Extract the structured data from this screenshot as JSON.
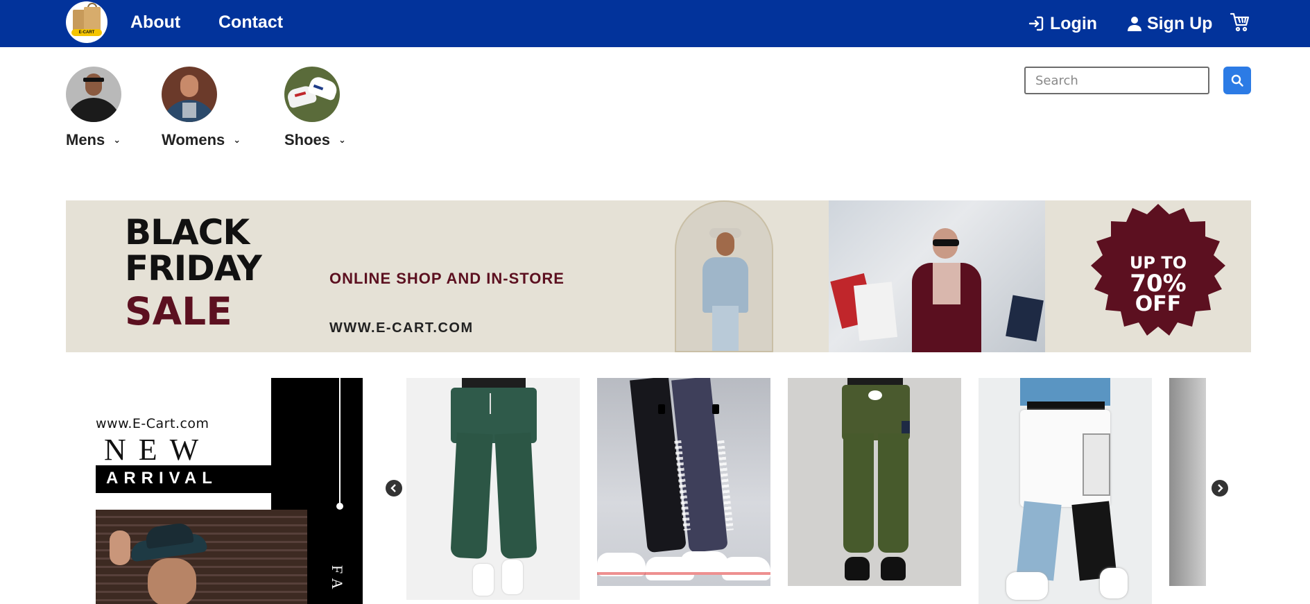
{
  "navbar": {
    "logo_text": "E-CART",
    "links": [
      "About",
      "Contact"
    ],
    "login_label": "Login",
    "signup_label": "Sign Up"
  },
  "categories": [
    {
      "label": "Mens"
    },
    {
      "label": "Womens"
    },
    {
      "label": "Shoes"
    }
  ],
  "search": {
    "placeholder": "Search"
  },
  "banner": {
    "line1": "BLACK",
    "line2": "FRIDAY",
    "line3": "SALE",
    "tagline": "ONLINE SHOP AND IN-STORE",
    "website": "WWW.E-CART.COM",
    "badge_line1": "UP TO",
    "badge_line2": "70%",
    "badge_line3": "OFF"
  },
  "promo": {
    "website": "www.E-Cart.com",
    "new": "NEW",
    "arrival": "ARRIVAL",
    "side_text": "FA"
  },
  "colors": {
    "navbar": "#02339b",
    "accent": "#2c7be5",
    "sale": "#5c1020"
  }
}
